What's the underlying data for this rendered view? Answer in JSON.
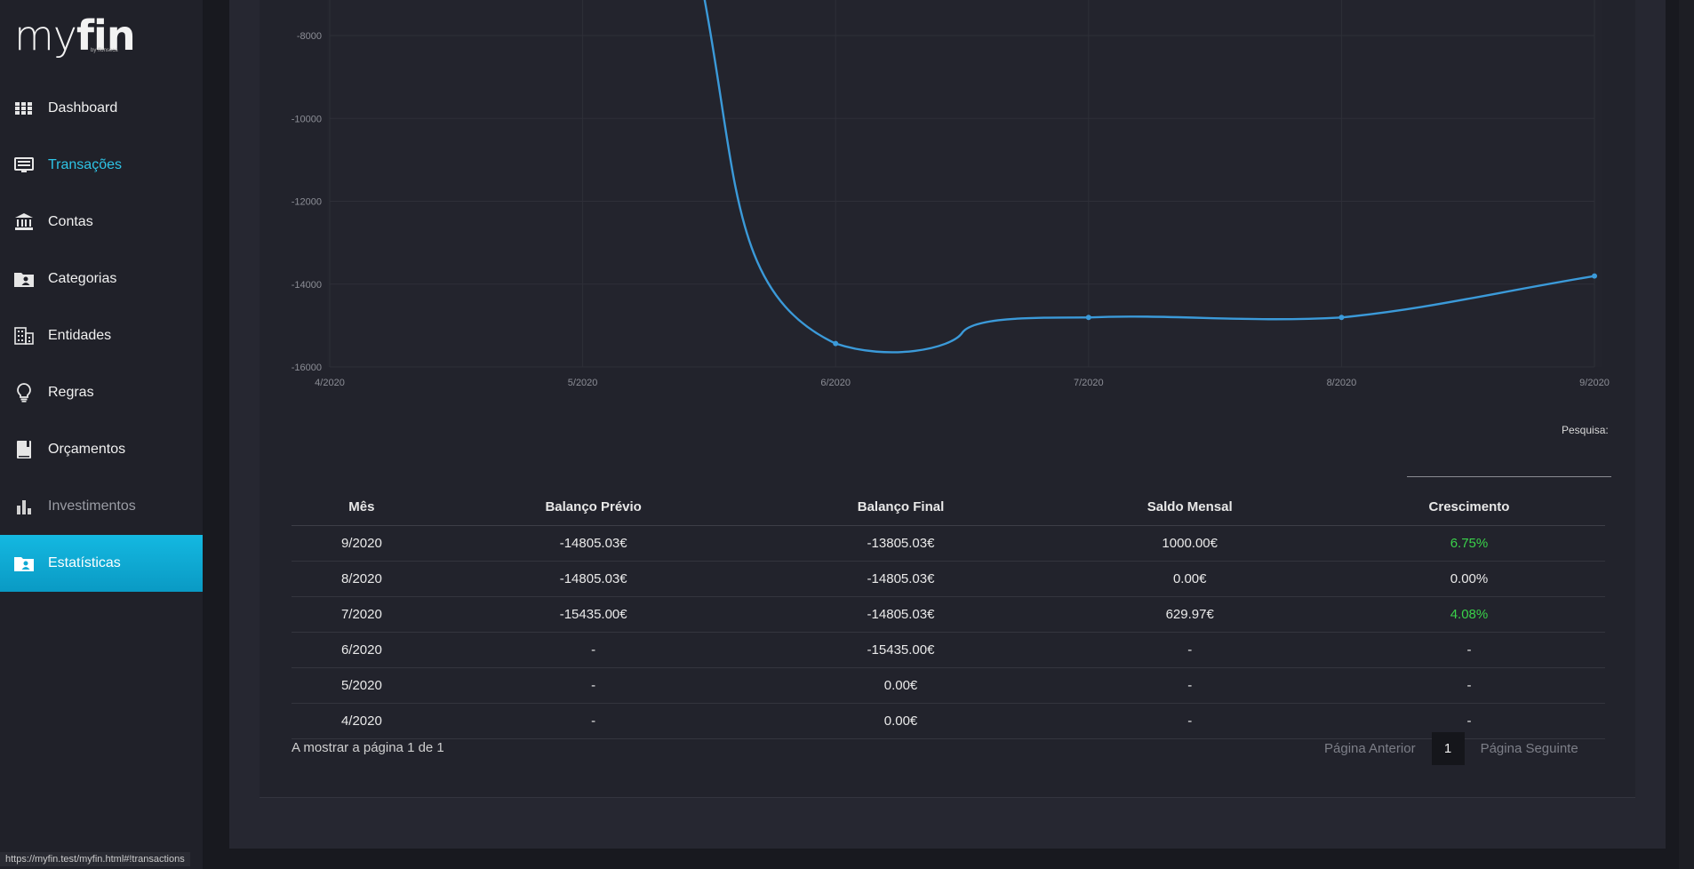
{
  "brand": {
    "name_light": "my",
    "name_bold": "fin",
    "sub": "by ffonseca"
  },
  "sidebar": {
    "items": [
      {
        "label": "Dashboard",
        "icon": "grid-icon"
      },
      {
        "label": "Transações",
        "icon": "monitor-icon"
      },
      {
        "label": "Contas",
        "icon": "bank-icon"
      },
      {
        "label": "Categorias",
        "icon": "folder-user-icon"
      },
      {
        "label": "Entidades",
        "icon": "building-icon"
      },
      {
        "label": "Regras",
        "icon": "lightbulb-icon"
      },
      {
        "label": "Orçamentos",
        "icon": "book-icon"
      },
      {
        "label": "Investimentos",
        "icon": "bar-chart-icon"
      },
      {
        "label": "Estatísticas",
        "icon": "folder-user-icon"
      }
    ]
  },
  "chart_data": {
    "type": "line",
    "x": [
      "4/2020",
      "5/2020",
      "6/2020",
      "7/2020",
      "8/2020",
      "9/2020"
    ],
    "series": [
      {
        "values": [
          null,
          null,
          -15435.0,
          -14805.03,
          -14805.03,
          -13805.03
        ]
      }
    ],
    "y_ticks": [
      "-8000",
      "-10000",
      "-12000",
      "-14000",
      "-16000"
    ],
    "ylim": [
      -16000,
      -7000
    ],
    "grid": true,
    "color": "#3b9ad9"
  },
  "search": {
    "label": "Pesquisa:"
  },
  "table": {
    "headers": [
      "Mês",
      "Balanço Prévio",
      "Balanço Final",
      "Saldo Mensal",
      "Crescimento"
    ],
    "rows": [
      [
        "9/2020",
        "-14805.03€",
        "-13805.03€",
        "1000.00€",
        "6.75%"
      ],
      [
        "8/2020",
        "-14805.03€",
        "-14805.03€",
        "0.00€",
        "0.00%"
      ],
      [
        "7/2020",
        "-15435.00€",
        "-14805.03€",
        "629.97€",
        "4.08%"
      ],
      [
        "6/2020",
        "-",
        "-15435.00€",
        "-",
        "-"
      ],
      [
        "5/2020",
        "-",
        "0.00€",
        "-",
        "-"
      ],
      [
        "4/2020",
        "-",
        "0.00€",
        "-",
        "-"
      ]
    ]
  },
  "pagination": {
    "info": "A mostrar a página 1 de 1",
    "prev": "Página Anterior",
    "current": "1",
    "next": "Página Seguinte"
  },
  "status_url": "https://myfin.test/myfin.html#!transactions",
  "colors": {
    "accent": "#14b8e1",
    "positive": "#3ad24a",
    "active_text": "#2ec4e6"
  }
}
